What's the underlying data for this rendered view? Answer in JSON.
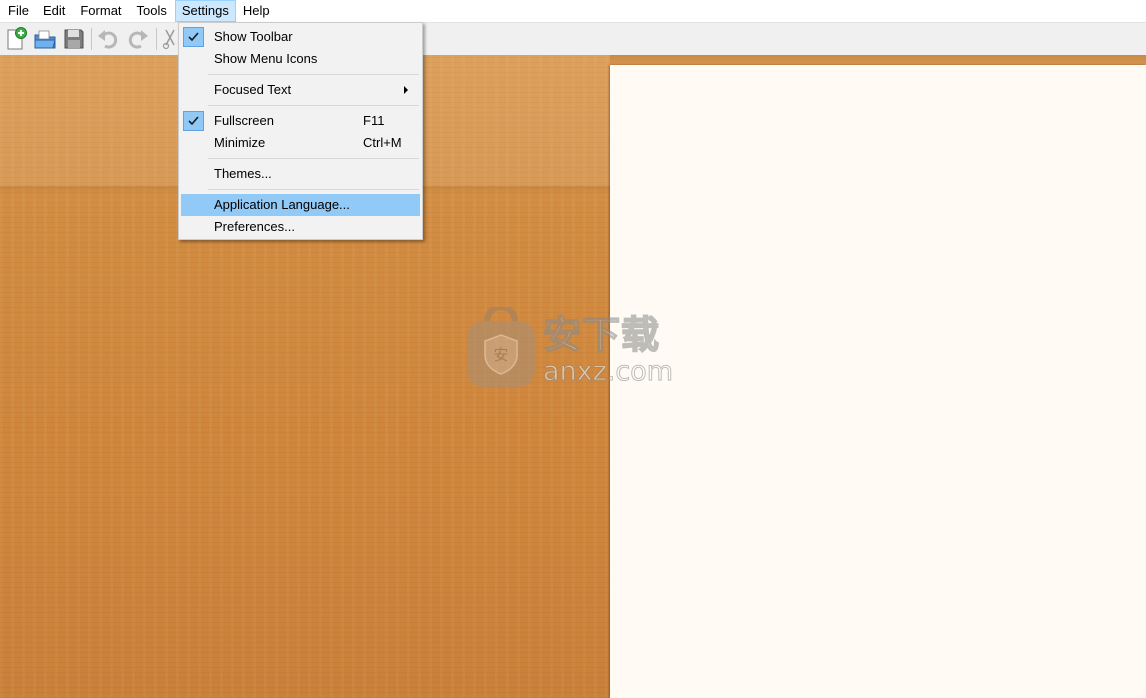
{
  "menubar": {
    "items": [
      {
        "label": "File"
      },
      {
        "label": "Edit"
      },
      {
        "label": "Format"
      },
      {
        "label": "Tools"
      },
      {
        "label": "Settings",
        "active": true
      },
      {
        "label": "Help"
      }
    ]
  },
  "toolbar": {
    "buttons": [
      {
        "icon": "new-document-icon"
      },
      {
        "icon": "open-folder-icon"
      },
      {
        "icon": "save-icon"
      },
      {
        "icon": "undo-icon",
        "enabled": false
      },
      {
        "icon": "redo-icon",
        "enabled": false
      },
      {
        "icon": "cut-icon",
        "enabled": false
      }
    ]
  },
  "settings_menu": {
    "items": [
      {
        "label": "Show Toolbar",
        "checked": true
      },
      {
        "label": "Show Menu Icons",
        "checked": false
      },
      {
        "label": "Focused Text",
        "submenu": true
      },
      {
        "label": "Fullscreen",
        "shortcut": "F11",
        "checked": true
      },
      {
        "label": "Minimize",
        "shortcut": "Ctrl+M"
      },
      {
        "label": "Themes..."
      },
      {
        "label": "Application Language...",
        "highlighted": true
      },
      {
        "label": "Preferences..."
      }
    ]
  },
  "watermark": {
    "text_cn": "安下载",
    "text_en": "anxz.com"
  },
  "colors": {
    "menu_active_bg": "#cce8ff",
    "menu_highlight_bg": "#91c9f7",
    "desk_wood": "#cf863c",
    "paper": "#fffbf4"
  }
}
